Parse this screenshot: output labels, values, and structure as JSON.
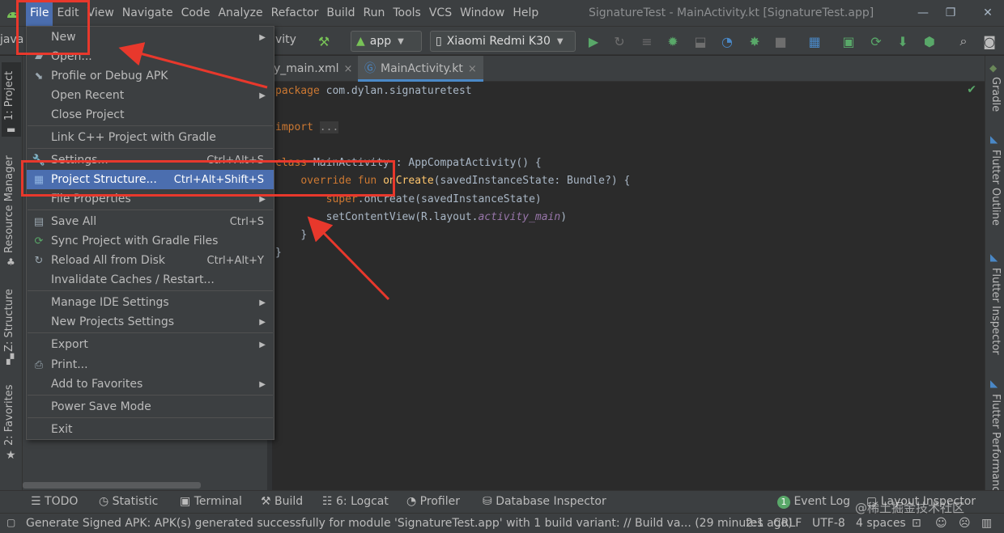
{
  "window": {
    "title": "SignatureTest - MainActivity.kt [SignatureTest.app]",
    "controls": [
      "—",
      "❐",
      "✕"
    ]
  },
  "menubar": {
    "items": [
      "File",
      "Edit",
      "View",
      "Navigate",
      "Code",
      "Analyze",
      "Refactor",
      "Build",
      "Run",
      "Tools",
      "VCS",
      "Window",
      "Help"
    ]
  },
  "toolbar": {
    "breadcrumb_left": "java",
    "breadcrumb_right": "vity",
    "run_config": "app",
    "device": "Xiaomi Redmi K30"
  },
  "left_tools": [
    "1: Project",
    "Resource Manager",
    "Z: Structure",
    "2: Favorites"
  ],
  "right_tools": [
    "Gradle",
    "Flutter Outline",
    "Flutter Inspector",
    "Flutter Performance"
  ],
  "editor_tabs": [
    {
      "label": "y_main.xml",
      "close": "×"
    },
    {
      "label": "MainActivity.kt",
      "close": "×"
    }
  ],
  "code": {
    "l1_kw": "package",
    "l1_rest": " com.dylan.signaturetest",
    "l2_kw": "import",
    "l2_fold": "...",
    "l3_pre": "class ",
    "l3_cls": "MainActivity",
    "l3_post": " : AppCompatActivity() {",
    "l4_kw": "override fun ",
    "l4_fn": "onCreate",
    "l4_post": "(savedInstanceState: Bundle?) {",
    "l5_kw": "super",
    "l5_post": ".onCreate(savedInstanceState)",
    "l6_pre": "setContentView(R.layout.",
    "l6_it": "activity_main",
    "l6_post": ")",
    "l7": "}",
    "l8": "}"
  },
  "file_menu": {
    "items": [
      {
        "label": "New",
        "shortcut": "",
        "submenu": true
      },
      {
        "label": "Open...",
        "shortcut": "",
        "submenu": false
      },
      {
        "label": "Profile or Debug APK",
        "shortcut": "",
        "submenu": false
      },
      {
        "label": "Open Recent",
        "shortcut": "",
        "submenu": true
      },
      {
        "label": "Close Project",
        "shortcut": "",
        "submenu": false
      },
      {
        "label": "Link C++ Project with Gradle",
        "shortcut": "",
        "submenu": false
      },
      {
        "label": "Settings...",
        "shortcut": "Ctrl+Alt+S",
        "submenu": false
      },
      {
        "label": "Project Structure...",
        "shortcut": "Ctrl+Alt+Shift+S",
        "submenu": false
      },
      {
        "label": "File Properties",
        "shortcut": "",
        "submenu": true
      },
      {
        "label": "Save All",
        "shortcut": "Ctrl+S",
        "submenu": false
      },
      {
        "label": "Sync Project with Gradle Files",
        "shortcut": "",
        "submenu": false
      },
      {
        "label": "Reload All from Disk",
        "shortcut": "Ctrl+Alt+Y",
        "submenu": false
      },
      {
        "label": "Invalidate Caches / Restart...",
        "shortcut": "",
        "submenu": false
      },
      {
        "label": "Manage IDE Settings",
        "shortcut": "",
        "submenu": true
      },
      {
        "label": "New Projects Settings",
        "shortcut": "",
        "submenu": true
      },
      {
        "label": "Export",
        "shortcut": "",
        "submenu": true
      },
      {
        "label": "Print...",
        "shortcut": "",
        "submenu": false
      },
      {
        "label": "Add to Favorites",
        "shortcut": "",
        "submenu": true
      },
      {
        "label": "Power Save Mode",
        "shortcut": "",
        "submenu": false
      },
      {
        "label": "Exit",
        "shortcut": "",
        "submenu": false
      }
    ]
  },
  "tool_windows": {
    "todo": "TODO",
    "statistic": "Statistic",
    "terminal": "Terminal",
    "build": "Build",
    "logcat": "6: Logcat",
    "profiler": "Profiler",
    "db_inspector": "Database Inspector",
    "event_log": "Event Log",
    "layout_inspector": "Layout Inspector",
    "event_count": "1"
  },
  "status": {
    "message": "Generate Signed APK: APK(s) generated successfully for module 'SignatureTest.app' with 1 build variant: // Build va... (29 minutes ago)",
    "position": "2:1",
    "line_sep": "CRLF",
    "encoding": "UTF-8",
    "indent": "4 spaces"
  },
  "watermark": "@稀土掘金技术社区",
  "colors": {
    "accent": "#4b6eaf",
    "annotation": "#e8382c",
    "keyword": "#cc7832",
    "function": "#ffc66d"
  }
}
